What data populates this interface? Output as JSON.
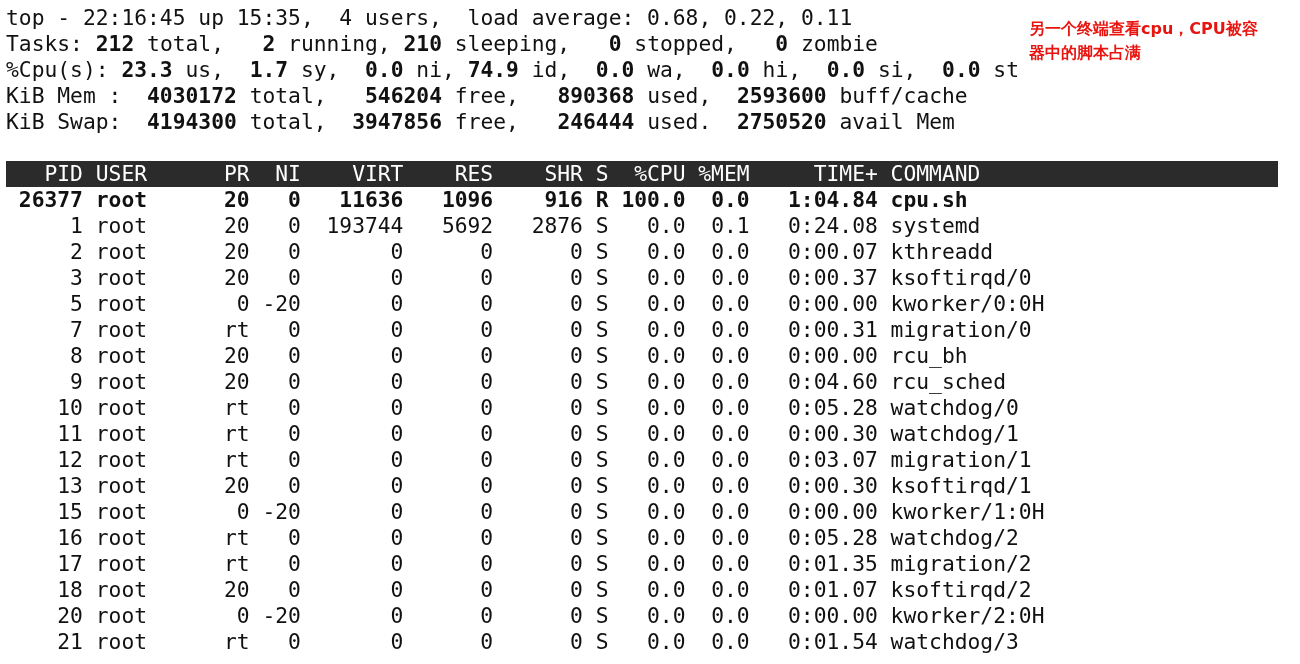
{
  "summary": [
    "top - 22:16:45 up 15:35,  4 users,  load average: 0.68, 0.22, 0.11",
    "Tasks: **212** total,   **2** running, **210** sleeping,   **0** stopped,   **0** zombie",
    "%Cpu(s): **23.3** us,  **1.7** sy,  **0.0** ni, **74.9** id,  **0.0** wa,  **0.0** hi,  **0.0** si,  **0.0** st",
    "KiB Mem :  **4030172** total,   **546204** free,   **890368** used,  **2593600** buff/cache",
    "KiB Swap:  **4194300** total,  **3947856** free,   **246444** used.  **2750520** avail Mem"
  ],
  "annotation": "另一个终端查看cpu，CPU被容器中的脚本占满",
  "columns": [
    "PID",
    "USER",
    "PR",
    "NI",
    "VIRT",
    "RES",
    "SHR",
    "S",
    "%CPU",
    "%MEM",
    "TIME+",
    "COMMAND"
  ],
  "processes": [
    {
      "highlighted": true,
      "cells": [
        "26377",
        "root",
        "20",
        "0",
        "11636",
        "1096",
        "916",
        "R",
        "100.0",
        "0.0",
        "1:04.84",
        "cpu.sh"
      ]
    },
    {
      "highlighted": false,
      "cells": [
        "1",
        "root",
        "20",
        "0",
        "193744",
        "5692",
        "2876",
        "S",
        "0.0",
        "0.1",
        "0:24.08",
        "systemd"
      ]
    },
    {
      "highlighted": false,
      "cells": [
        "2",
        "root",
        "20",
        "0",
        "0",
        "0",
        "0",
        "S",
        "0.0",
        "0.0",
        "0:00.07",
        "kthreadd"
      ]
    },
    {
      "highlighted": false,
      "cells": [
        "3",
        "root",
        "20",
        "0",
        "0",
        "0",
        "0",
        "S",
        "0.0",
        "0.0",
        "0:00.37",
        "ksoftirqd/0"
      ]
    },
    {
      "highlighted": false,
      "cells": [
        "5",
        "root",
        "0",
        "-20",
        "0",
        "0",
        "0",
        "S",
        "0.0",
        "0.0",
        "0:00.00",
        "kworker/0:0H"
      ]
    },
    {
      "highlighted": false,
      "cells": [
        "7",
        "root",
        "rt",
        "0",
        "0",
        "0",
        "0",
        "S",
        "0.0",
        "0.0",
        "0:00.31",
        "migration/0"
      ]
    },
    {
      "highlighted": false,
      "cells": [
        "8",
        "root",
        "20",
        "0",
        "0",
        "0",
        "0",
        "S",
        "0.0",
        "0.0",
        "0:00.00",
        "rcu_bh"
      ]
    },
    {
      "highlighted": false,
      "cells": [
        "9",
        "root",
        "20",
        "0",
        "0",
        "0",
        "0",
        "S",
        "0.0",
        "0.0",
        "0:04.60",
        "rcu_sched"
      ]
    },
    {
      "highlighted": false,
      "cells": [
        "10",
        "root",
        "rt",
        "0",
        "0",
        "0",
        "0",
        "S",
        "0.0",
        "0.0",
        "0:05.28",
        "watchdog/0"
      ]
    },
    {
      "highlighted": false,
      "cells": [
        "11",
        "root",
        "rt",
        "0",
        "0",
        "0",
        "0",
        "S",
        "0.0",
        "0.0",
        "0:00.30",
        "watchdog/1"
      ]
    },
    {
      "highlighted": false,
      "cells": [
        "12",
        "root",
        "rt",
        "0",
        "0",
        "0",
        "0",
        "S",
        "0.0",
        "0.0",
        "0:03.07",
        "migration/1"
      ]
    },
    {
      "highlighted": false,
      "cells": [
        "13",
        "root",
        "20",
        "0",
        "0",
        "0",
        "0",
        "S",
        "0.0",
        "0.0",
        "0:00.30",
        "ksoftirqd/1"
      ]
    },
    {
      "highlighted": false,
      "cells": [
        "15",
        "root",
        "0",
        "-20",
        "0",
        "0",
        "0",
        "S",
        "0.0",
        "0.0",
        "0:00.00",
        "kworker/1:0H"
      ]
    },
    {
      "highlighted": false,
      "cells": [
        "16",
        "root",
        "rt",
        "0",
        "0",
        "0",
        "0",
        "S",
        "0.0",
        "0.0",
        "0:05.28",
        "watchdog/2"
      ]
    },
    {
      "highlighted": false,
      "cells": [
        "17",
        "root",
        "rt",
        "0",
        "0",
        "0",
        "0",
        "S",
        "0.0",
        "0.0",
        "0:01.35",
        "migration/2"
      ]
    },
    {
      "highlighted": false,
      "cells": [
        "18",
        "root",
        "20",
        "0",
        "0",
        "0",
        "0",
        "S",
        "0.0",
        "0.0",
        "0:01.07",
        "ksoftirqd/2"
      ]
    },
    {
      "highlighted": false,
      "cells": [
        "20",
        "root",
        "0",
        "-20",
        "0",
        "0",
        "0",
        "S",
        "0.0",
        "0.0",
        "0:00.00",
        "kworker/2:0H"
      ]
    },
    {
      "highlighted": false,
      "cells": [
        "21",
        "root",
        "rt",
        "0",
        "0",
        "0",
        "0",
        "S",
        "0.0",
        "0.0",
        "0:01.54",
        "watchdog/3"
      ]
    }
  ]
}
